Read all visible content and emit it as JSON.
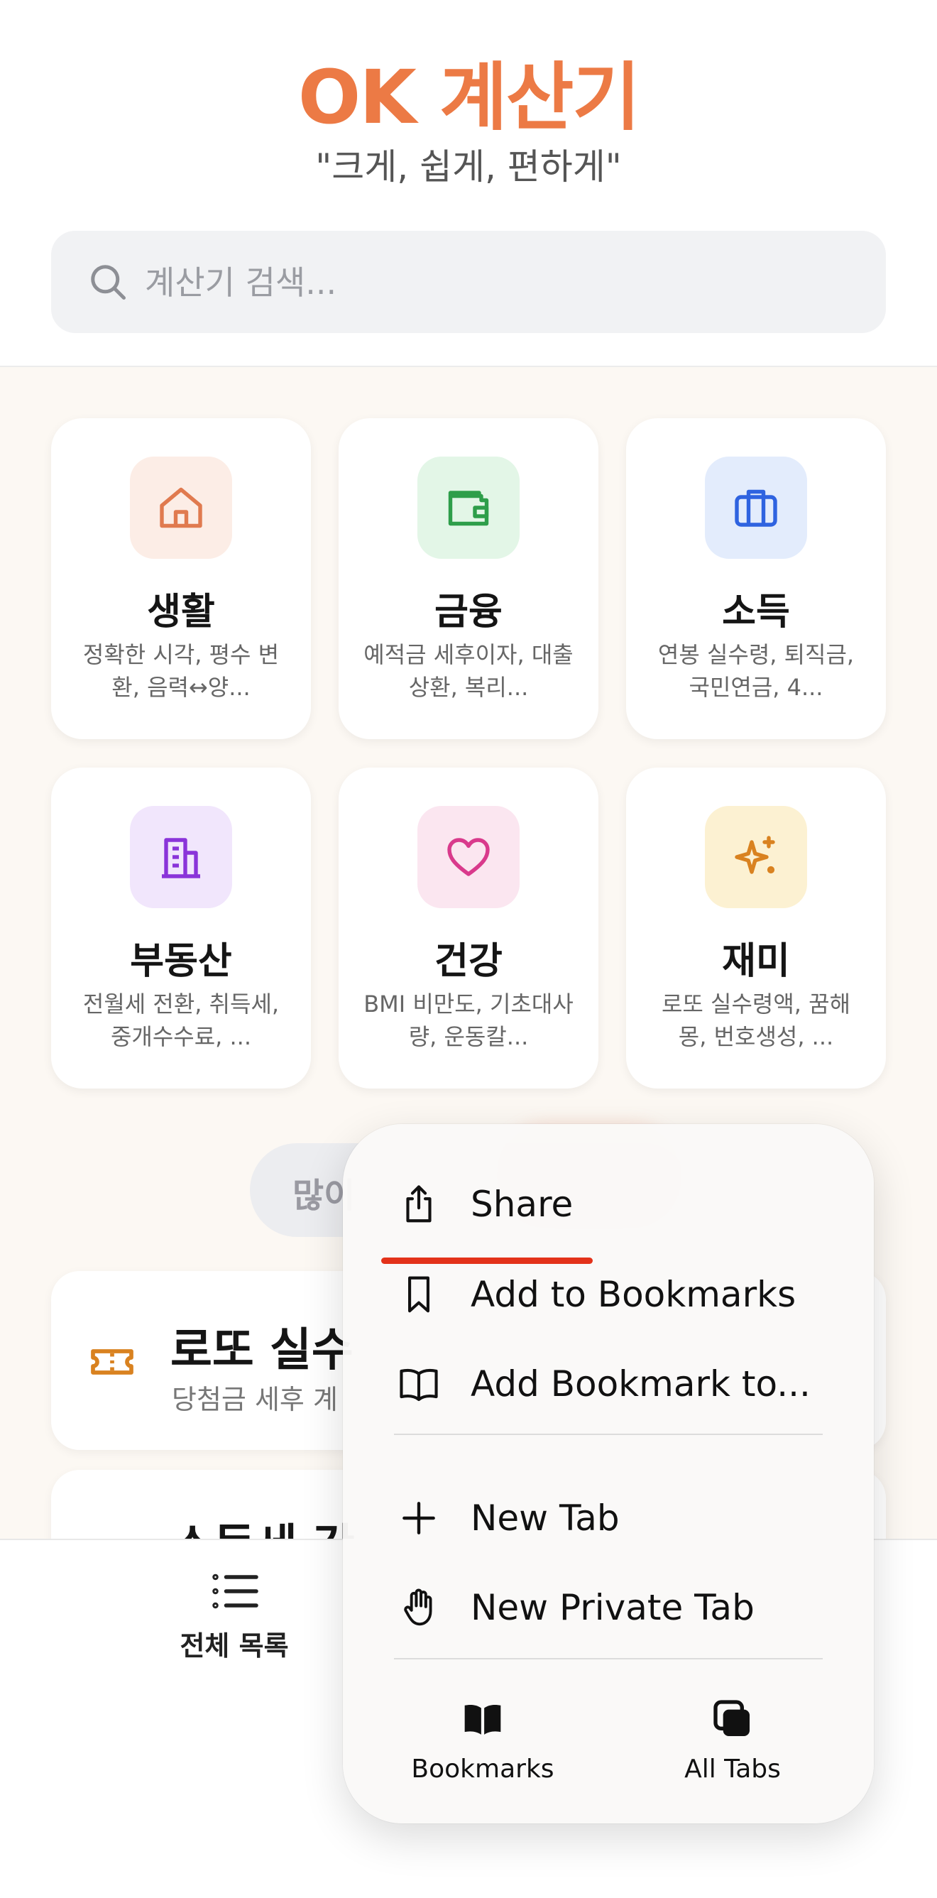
{
  "header": {
    "title": "OK 계산기",
    "slogan": "\"크게, 쉽게, 편하게\"",
    "search_placeholder": "계산기 검색..."
  },
  "categories": [
    {
      "title": "생활",
      "desc": "정확한 시각, 평수 변환, 음력↔양...",
      "icon": "home-icon",
      "color": "#E07A4F",
      "bg": "#FCEDE6"
    },
    {
      "title": "금융",
      "desc": "예적금 세후이자, 대출상환, 복리...",
      "icon": "wallet-icon",
      "color": "#2E9E4A",
      "bg": "#E3F6E7"
    },
    {
      "title": "소득",
      "desc": "연봉 실수령, 퇴직금, 국민연금, 4...",
      "icon": "briefcase-icon",
      "color": "#2F63E0",
      "bg": "#E3ECFC"
    },
    {
      "title": "부동산",
      "desc": "전월세 전환, 취득세, 중개수수료, ...",
      "icon": "building-icon",
      "color": "#8A34D9",
      "bg": "#F1E6FC"
    },
    {
      "title": "건강",
      "desc": "BMI 비만도, 기초대사량, 운동칼...",
      "icon": "heart-icon",
      "color": "#D93A8C",
      "bg": "#FBE6F0"
    },
    {
      "title": "재미",
      "desc": "로또 실수령액, 꿈해몽, 번호생성, ...",
      "icon": "sparkles-icon",
      "color": "#D98220",
      "bg": "#FCF1D2"
    }
  ],
  "popular_tab_label": "많이",
  "list": [
    {
      "title": "로또 실수",
      "sub": "당첨금 세후 계",
      "icon": "ticket-icon"
    },
    {
      "title": "소득세 간",
      "sub": ""
    }
  ],
  "tabbar": {
    "all_label": "전체 목록"
  },
  "menu": {
    "items": [
      {
        "label": "Share",
        "icon": "share-icon"
      },
      {
        "label": "Add to Bookmarks",
        "icon": "bookmark-icon"
      },
      {
        "label": "Add Bookmark to...",
        "icon": "open-book-icon"
      },
      {
        "label": "New Tab",
        "icon": "plus-icon"
      },
      {
        "label": "New Private Tab",
        "icon": "hand-icon"
      }
    ],
    "bookmarks_label": "Bookmarks",
    "all_tabs_label": "All Tabs",
    "underline_color": "#E3321A"
  }
}
